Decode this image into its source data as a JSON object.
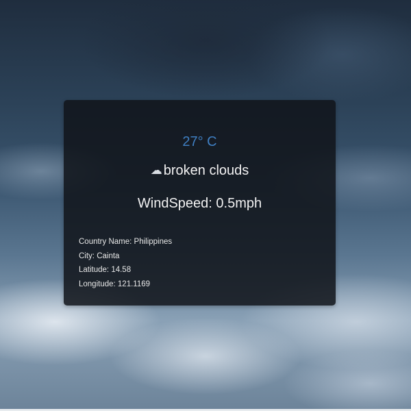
{
  "weather": {
    "temperature": "27° C",
    "condition_icon": "cloud-icon",
    "condition": "broken clouds",
    "wind_speed": "WindSpeed: 0.5mph",
    "accent_color": "#3f7fc2"
  },
  "location": {
    "country": "Country Name: Philippines",
    "city": "City: Cainta",
    "latitude": "Latitude: 14.58",
    "longitude": "Longitude: 121.1169"
  }
}
